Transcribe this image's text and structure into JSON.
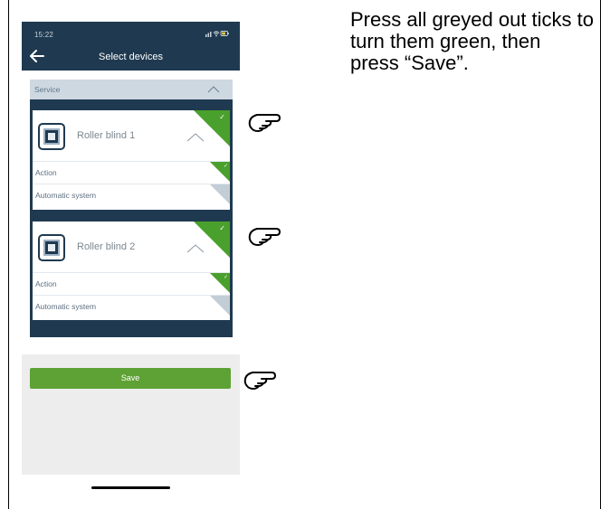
{
  "status_bar": {
    "time": "15:22",
    "icons": [
      "signal-icon",
      "wifi-icon",
      "battery-icon"
    ]
  },
  "header": {
    "title": "Select devices",
    "back_icon": "arrow-left-icon"
  },
  "section": {
    "label": "Service",
    "state": "expanded"
  },
  "devices": [
    {
      "name": "Roller blind 1",
      "selected": true,
      "rows": [
        {
          "label": "Action",
          "selected": true
        },
        {
          "label": "Automatic system",
          "selected": false
        }
      ]
    },
    {
      "name": "Roller blind 2",
      "selected": true,
      "rows": [
        {
          "label": "Action",
          "selected": true
        },
        {
          "label": "Automatic system",
          "selected": false
        }
      ]
    }
  ],
  "save_label": "Save",
  "instruction": "Press all greyed out ticks to turn them green, then press “Save”.",
  "colors": {
    "header": "#1f3a50",
    "tick_selected": "#4aa02c",
    "tick_unselected": "#c3cdd6",
    "save_button": "#5ea135",
    "section_bar": "#ced8e1"
  }
}
